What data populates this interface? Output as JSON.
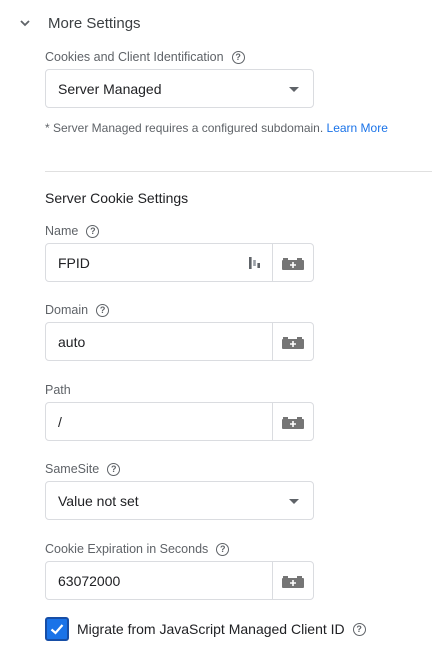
{
  "section": {
    "title": "More Settings"
  },
  "cookies": {
    "label": "Cookies and Client Identification",
    "value": "Server Managed",
    "note": "* Server Managed requires a configured subdomain.",
    "learn_more": "Learn More"
  },
  "server_cookie": {
    "title": "Server Cookie Settings",
    "name": {
      "label": "Name",
      "value": "FPID"
    },
    "domain": {
      "label": "Domain",
      "value": "auto"
    },
    "path": {
      "label": "Path",
      "value": "/"
    },
    "samesite": {
      "label": "SameSite",
      "value": "Value not set"
    },
    "expiration": {
      "label": "Cookie Expiration in Seconds",
      "value": "63072000"
    }
  },
  "migrate": {
    "label": "Migrate from JavaScript Managed Client ID",
    "checked": true
  },
  "help_glyph": "?",
  "colors": {
    "accent": "#1a73e8",
    "border": "#dadce0",
    "muted": "#5f6368"
  },
  "icons": {
    "chevron": "chevron-down-icon",
    "help": "help-circle-icon",
    "variable": "variable-brick-icon",
    "gtm": "gtm-logo-icon",
    "check": "check-icon"
  }
}
